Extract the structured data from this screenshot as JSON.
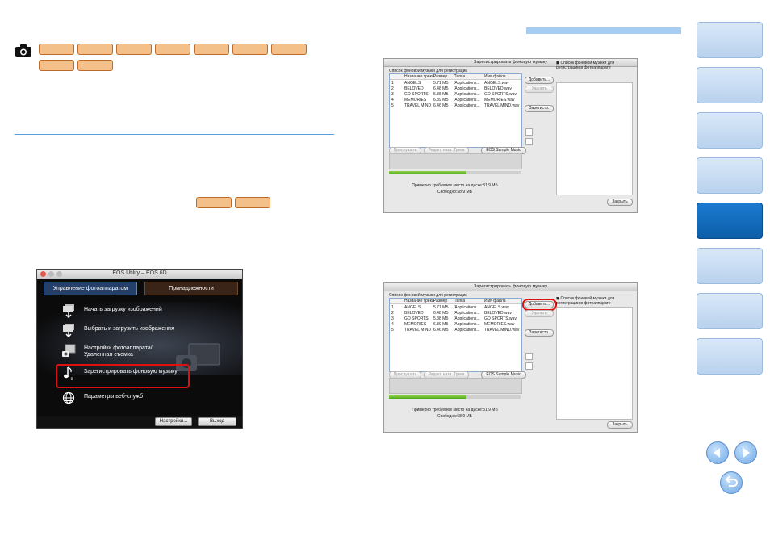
{
  "eos_window": {
    "title": "EOS Utility – EOS 6D",
    "tab_camera": "Управление фотоаппаратом",
    "tab_accessories": "Принадлежности",
    "items": [
      {
        "label": "Начать загрузку изображений",
        "icon": "download-images-icon"
      },
      {
        "label": "Выбрать и загрузить изображения",
        "icon": "select-download-icon"
      },
      {
        "label": "Настройки фотоаппарата/\nУдаленная съемка",
        "icon": "camera-settings-icon"
      },
      {
        "label": "Зарегистрировать фоновую музыку",
        "icon": "music-note-icon"
      },
      {
        "label": "Параметры веб-служб",
        "icon": "globe-icon"
      }
    ],
    "settings_button": "Настройки...",
    "quit_button": "Выход"
  },
  "music_dialog": {
    "title": "Зарегистрировать фоновую музыку",
    "list_label": "Список фоновой музыки для регистрации",
    "columns": [
      "Название трека",
      "Размер",
      "Папка",
      "Имя файла"
    ],
    "tracks": [
      {
        "n": "1",
        "name": "ANGELS",
        "size": "5.71 MБ",
        "folder": "/Applications...",
        "file": "ANGELS.wav"
      },
      {
        "n": "2",
        "name": "BELOVED",
        "size": "6.48 MБ",
        "folder": "/Applications...",
        "file": "BELOVED.wav"
      },
      {
        "n": "3",
        "name": "GO SPORTS",
        "size": "5.38 MБ",
        "folder": "/Applications...",
        "file": "GO SPORTS.wav"
      },
      {
        "n": "4",
        "name": "MEMORIES",
        "size": "6.39 MБ",
        "folder": "/Applications...",
        "file": "MEMORIES.wav"
      },
      {
        "n": "5",
        "name": "TRAVEL MIND",
        "size": "6.46 MБ",
        "folder": "/Applications...",
        "file": "TRAVEL MIND.wav"
      }
    ],
    "add_button": "Добавить...",
    "delete_button": "Удалить",
    "register_button": "Зарегистр.",
    "play_button": "Прослушать",
    "edit_title_button": "Редакт. назв. Трека",
    "sample_button": "EOS Sample Music",
    "required_space": "Примерно требуемое место на диске:31.9 MБ",
    "free_space": "Свободно:58.9 MБ",
    "camera_list_label": "Список фоновой музыки для регистрации в фотоаппарате",
    "close_button": "Закрыть",
    "progress": 0.58
  }
}
